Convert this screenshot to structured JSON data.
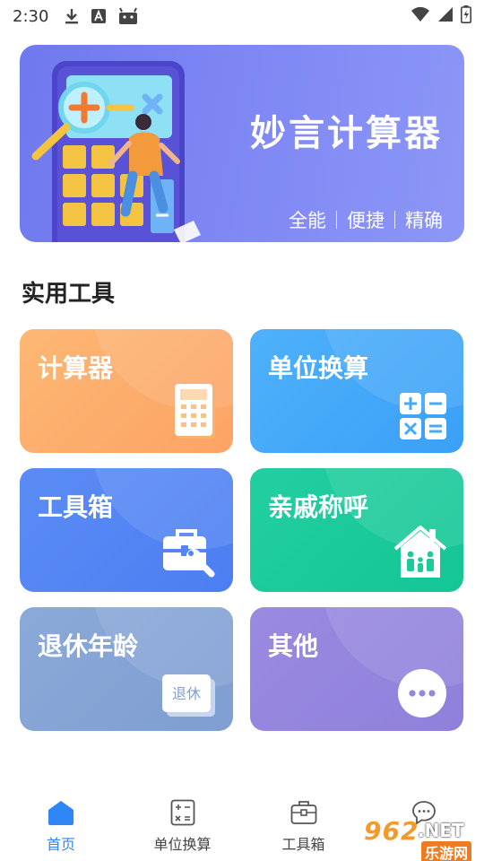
{
  "status_bar": {
    "time": "2:30",
    "icons": [
      "download-icon",
      "a-icon",
      "android-icon"
    ],
    "right_icons": [
      "wifi-icon",
      "signal-icon",
      "battery-icon"
    ]
  },
  "banner": {
    "title": "妙言计算器",
    "features": [
      "全能",
      "便捷",
      "精确"
    ]
  },
  "section": {
    "title": "实用工具"
  },
  "tools": [
    {
      "label": "计算器",
      "icon": "calculator-icon",
      "color": "#fdb06e"
    },
    {
      "label": "单位换算",
      "icon": "math-operators-icon",
      "color": "#45a9f9"
    },
    {
      "label": "工具箱",
      "icon": "toolbox-icon",
      "color": "#5485f3"
    },
    {
      "label": "亲戚称呼",
      "icon": "family-house-icon",
      "color": "#1ccb9b"
    },
    {
      "label": "退休年龄",
      "icon": "retire-cards-icon",
      "icon_text": "退休",
      "color": "#86a4d5"
    },
    {
      "label": "其他",
      "icon": "more-icon",
      "color": "#9585dd"
    }
  ],
  "bottom_nav": {
    "items": [
      {
        "label": "首页",
        "icon": "home-icon",
        "active": true
      },
      {
        "label": "单位换算",
        "icon": "calculator-outline-icon",
        "active": false
      },
      {
        "label": "工具箱",
        "icon": "toolbox-outline-icon",
        "active": false
      },
      {
        "label": "",
        "icon": "chat-icon",
        "active": false
      }
    ],
    "active_color": "#2f86f6"
  },
  "watermark": {
    "number": "962",
    "suffix": ".NET",
    "site": "乐游网"
  }
}
